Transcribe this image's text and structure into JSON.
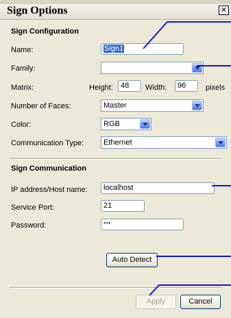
{
  "window": {
    "title": "Sign Options",
    "close_glyph": "✕"
  },
  "sign_configuration": {
    "heading": "Sign Configuration",
    "name_label": "Name:",
    "name_value": "Sign1",
    "family_label": "Family:",
    "family_value": "",
    "matrix_label": "Matrix:",
    "height_label": "Height:",
    "height_value": "48",
    "width_label": "Width:",
    "width_value": "96",
    "pixels_label": "pixels",
    "faces_label": "Number of Faces:",
    "faces_value": "Master",
    "color_label": "Color:",
    "color_value": "RGB",
    "comm_type_label": "Communication Type:",
    "comm_type_value": "Ethernet"
  },
  "sign_communication": {
    "heading": "Sign Communication",
    "ip_label": "IP address/Host name:",
    "ip_value": "localhost",
    "port_label": "Service Port:",
    "port_value": "21",
    "password_label": "Password:",
    "password_value": "***",
    "auto_detect_label": "Auto Detect"
  },
  "footer": {
    "apply_label": "Apply",
    "cancel_label": "Cancel"
  },
  "colors": {
    "callout": "#0a1ad6",
    "dialog_bg": "#ece9d8",
    "selection": "#316ac5"
  }
}
